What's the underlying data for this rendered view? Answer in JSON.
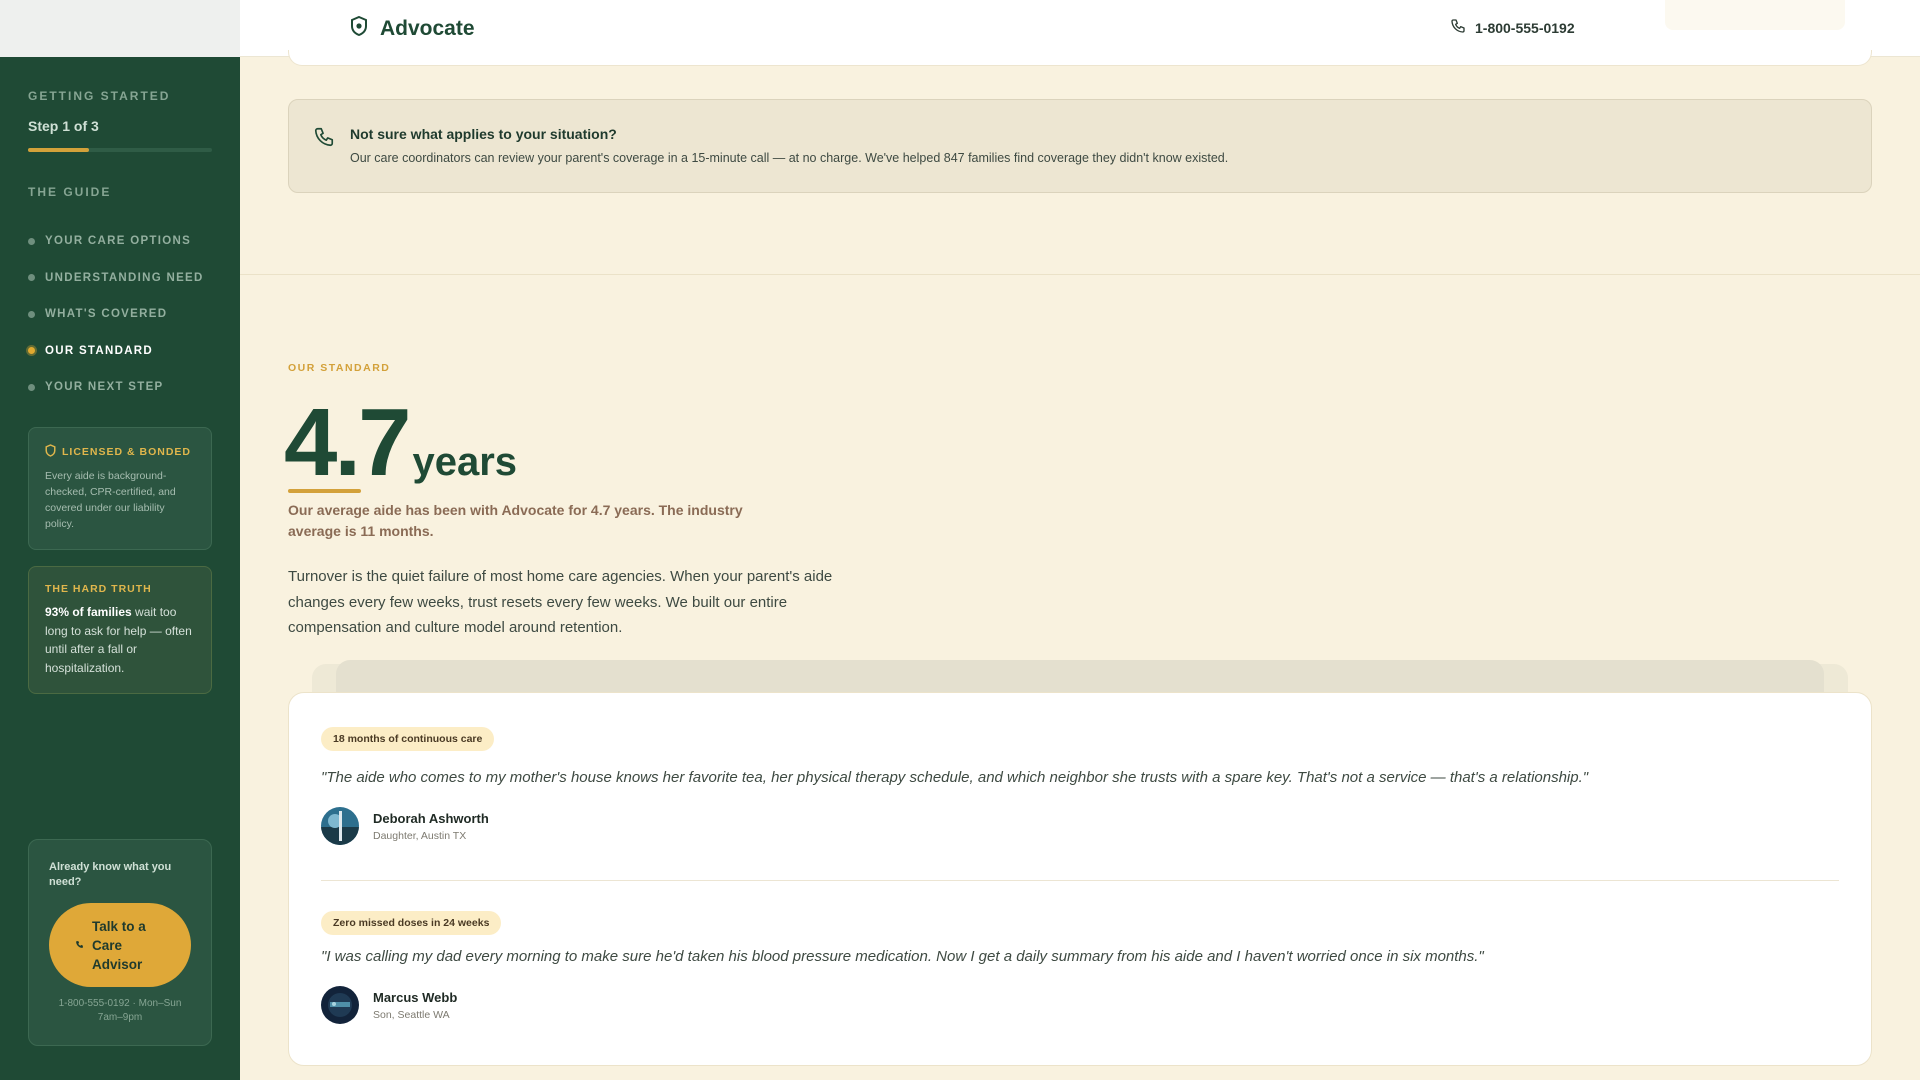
{
  "header": {
    "brand_name": "Advocate",
    "phone": "1-800-555-0192"
  },
  "sidebar": {
    "eyebrow": "GETTING STARTED",
    "step": "Step 1 of 3",
    "progress": 0.33,
    "guide_label": "THE GUIDE",
    "items": [
      {
        "label": "YOUR CARE OPTIONS",
        "active": false
      },
      {
        "label": "UNDERSTANDING NEED",
        "active": false
      },
      {
        "label": "WHAT'S COVERED",
        "active": false
      },
      {
        "label": "OUR STANDARD",
        "active": true
      },
      {
        "label": "YOUR NEXT STEP",
        "active": false
      }
    ],
    "licensed": {
      "title": "LICENSED & BONDED",
      "body": "Every aide is background-checked, CPR-certified, and covered under our liability policy."
    },
    "hard_truth": {
      "title": "THE HARD TRUTH",
      "bold": "93% of families",
      "body": " wait too long to ask for help — often until after a fall or hospitalization."
    },
    "cta": {
      "question": "Already know what you need?",
      "button_label": "Talk to a Care Advisor",
      "phone_hours": "1-800-555-0192 · Mon–Sun 7am–9pm"
    }
  },
  "callout": {
    "title": "Not sure what applies to your situation?",
    "body": "Our care coordinators can review your parent's coverage in a 15-minute call — at no charge. We've helped 847 families find coverage they didn't know existed."
  },
  "standard": {
    "eyebrow": "OUR STANDARD",
    "stat_value": "4.7",
    "stat_unit": "years",
    "caption": "Our average aide has been with Advocate for 4.7 years. The industry average is 11 months.",
    "lead": "Turnover is the quiet failure of most home care agencies. When your parent's aide changes every few weeks, trust resets every few weeks. We built our entire compensation and culture model around retention."
  },
  "testimonials": [
    {
      "badge": "18 months of continuous care",
      "quote": "\"The aide who comes to my mother's house knows her favorite tea, her physical therapy schedule, and which neighbor she trusts with a spare key. That's not a service — that's a relationship.\"",
      "name": "Deborah Ashworth",
      "role": "Daughter, Austin TX"
    },
    {
      "badge": "Zero missed doses in 24 weeks",
      "quote": "\"I was calling my dad every morning to make sure he'd taken his blood pressure medication. Now I get a daily summary from his aide and I haven't worried once in six months.\"",
      "name": "Marcus Webb",
      "role": "Son, Seattle WA"
    }
  ],
  "colors": {
    "sidebar_bg": "#1f4a35",
    "accent_gold": "#d3a13a",
    "page_bg": "#f9f2df"
  }
}
